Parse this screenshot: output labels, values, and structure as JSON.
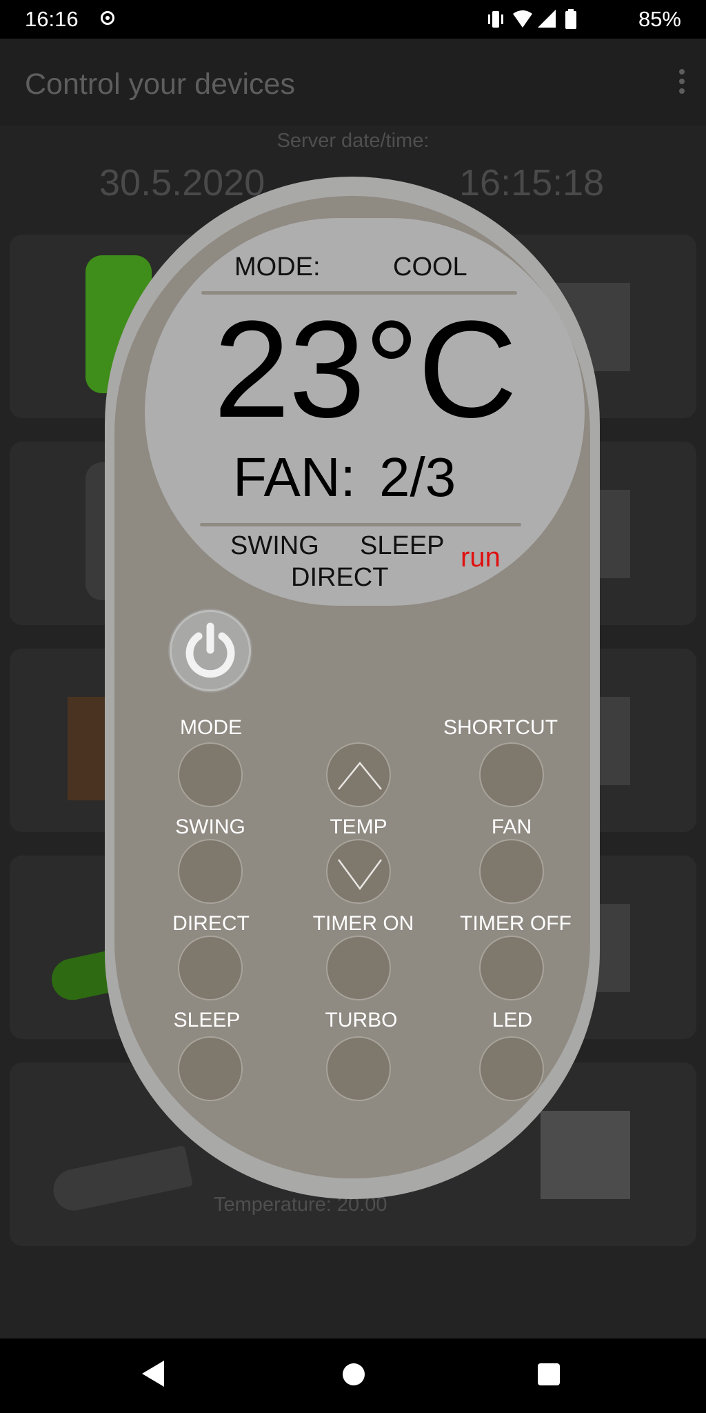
{
  "status_bar": {
    "time": "16:16",
    "battery_pct": "85%",
    "icons": [
      "cast-icon",
      "vibrate-icon",
      "wifi-icon",
      "signal-icon",
      "battery-icon"
    ]
  },
  "app_bar": {
    "title": "Control your devices"
  },
  "server": {
    "label": "Server date/time:",
    "date": "30.5.2020",
    "time": "16:15:18"
  },
  "background_cards": {
    "last_card_sub": "Temperature: 20.00"
  },
  "remote": {
    "mode_label": "MODE:",
    "mode_value": "COOL",
    "temperature": "23°C",
    "fan_label": "FAN:",
    "fan_value": "2/3",
    "flag_swing": "SWING",
    "flag_sleep": "SLEEP",
    "flag_direct": "DIRECT",
    "run_label": "run",
    "buttons": {
      "mode": "MODE",
      "shortcut": "SHORTCUT",
      "swing": "SWING",
      "temp": "TEMP",
      "fan": "FAN",
      "direct": "DIRECT",
      "timer_on": "TIMER ON",
      "timer_off": "TIMER OFF",
      "sleep": "SLEEP",
      "turbo": "TURBO",
      "led": "LED"
    }
  },
  "colors": {
    "remote_shell": "#a9a9a7",
    "remote_body": "#8f8a82",
    "display_bg": "#aeaeae",
    "button_fill": "#7f786d",
    "run_red": "#e01010"
  }
}
